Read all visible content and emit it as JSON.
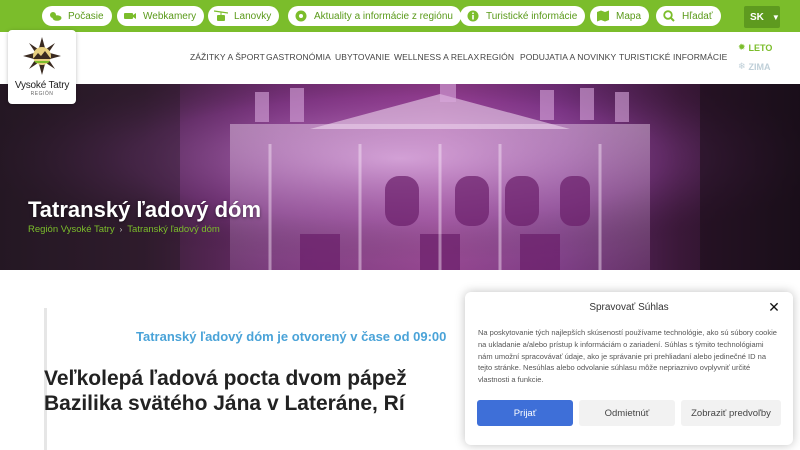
{
  "topbar": {
    "links": [
      {
        "label": "Počasie",
        "icon": "weather-icon"
      },
      {
        "label": "Webkamery",
        "icon": "webcam-icon"
      },
      {
        "label": "Lanovky",
        "icon": "cable-car-icon"
      },
      {
        "label": "Aktuality a informácie z regiónu",
        "icon": "news-icon"
      },
      {
        "label": "Turistické informácie",
        "icon": "tourist-info-icon"
      },
      {
        "label": "Mapa",
        "icon": "map-icon"
      },
      {
        "label": "Hľadať",
        "icon": "search-icon"
      }
    ],
    "language": "SK"
  },
  "logo": {
    "title": "Vysoké Tatry",
    "subtitle": "REGIÓN"
  },
  "nav": {
    "items": [
      "ZÁŽITKY A ŠPORT",
      "GASTRONÓMIA",
      "UBYTOVANIE",
      "WELLNESS A RELAX",
      "REGIÓN",
      "PODUJATIA A NOVINKY",
      "TURISTICKÉ INFORMÁCIE"
    ],
    "season_summer": "LETO",
    "season_winter": "ZIMA"
  },
  "hero": {
    "title": "Tatranský ľadový dóm",
    "breadcrumb": [
      "Región Vysoké Tatry",
      "Tatranský ľadový dóm"
    ]
  },
  "content": {
    "open_notice": "Tatranský ľadový dóm je otvorený v čase od 09:00",
    "headline_line1": "Veľkolepá ľadová pocta dvom pápež",
    "headline_line2": "Bazilika svätého Jána v Lateráne, Rí"
  },
  "cookie": {
    "title": "Spravovať Súhlas",
    "text": "Na poskytovanie tých najlepších skúseností používame technológie, ako sú súbory cookie na ukladanie a/alebo prístup k informáciám o zariadení. Súhlas s týmito technológiami nám umožní spracovávať údaje, ako je správanie pri prehliadaní alebo jedinečné ID na tejto stránke. Nesúhlas alebo odvolanie súhlasu môže nepriaznivo ovplyvniť určité vlastnosti a funkcie.",
    "accept_label": "Prijať",
    "deny_label": "Odmietnúť",
    "prefs_label": "Zobraziť predvoľby"
  },
  "colors": {
    "brand_green": "#7bbd2b",
    "notice_blue": "#4aa3d8",
    "accept_blue": "#3e6fd8"
  }
}
